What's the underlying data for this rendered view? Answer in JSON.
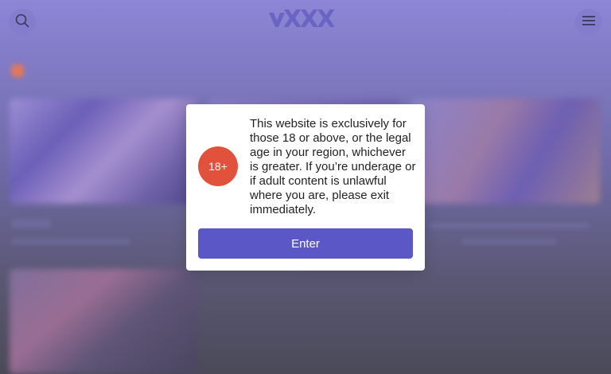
{
  "header": {
    "logo_text": "XXX",
    "search_icon": "search-icon",
    "menu_icon": "hamburger-menu-icon"
  },
  "colors": {
    "accent": "#5b57c6",
    "badge": "#e2513b",
    "logo": "#6a64c4"
  },
  "modal": {
    "badge": "18+",
    "message": "This website is exclusively for those 18 or above, or the legal age in your region, whichever is greater. If you’re underage or if adult content is unlawful where you are, please exit immediately.",
    "enter_label": "Enter"
  }
}
